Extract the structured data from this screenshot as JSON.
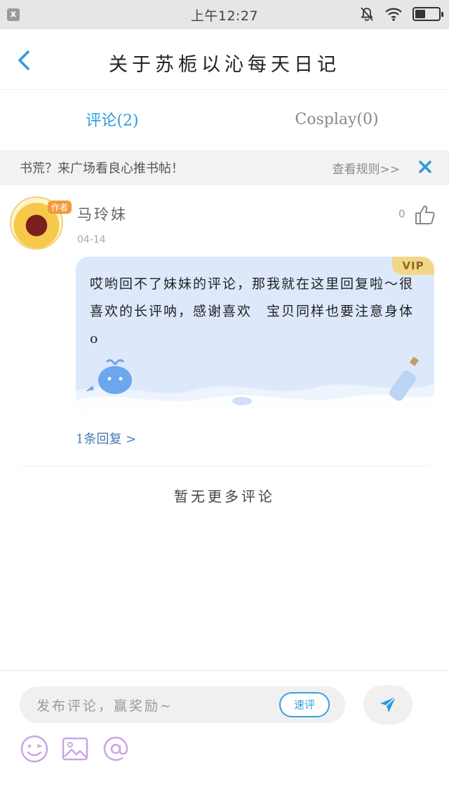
{
  "status_bar": {
    "time": "上午12:27",
    "close_glyph": "x"
  },
  "header": {
    "title": "关于苏栀以沁每天日记"
  },
  "tabs": [
    {
      "label": "评论(2)",
      "active": true
    },
    {
      "label": "Cosplay(0)",
      "active": false
    }
  ],
  "notice": {
    "text": "书荒？来广场看良心推书帖！",
    "link": "查看规则>>"
  },
  "comment": {
    "avatar_tag": "作者",
    "username": "马玲妹",
    "date": "04-14",
    "likes": "0",
    "vip_label": "VIP",
    "text": "哎哟回不了妹妹的评论，那我就在这里回复啦～很喜欢的长评呐，感谢喜欢　宝贝同样也要注意身体o",
    "reply_link": "1条回复 >"
  },
  "no_more_text": "暂无更多评论",
  "footer": {
    "input_placeholder": "发布评论，赢奖励~",
    "quick_button": "速评"
  },
  "colors": {
    "accent": "#2e9ad8",
    "bubble_bg": "#dde9fb",
    "vip_bg": "#f3d789",
    "icon_purple": "#c9a5e6"
  },
  "icons": {
    "back": "chevron-left-icon",
    "close": "close-icon",
    "like": "thumbs-up-icon",
    "send": "send-arrow-icon",
    "emoji": "emoji-icon",
    "image": "image-icon",
    "mention": "at-icon"
  }
}
